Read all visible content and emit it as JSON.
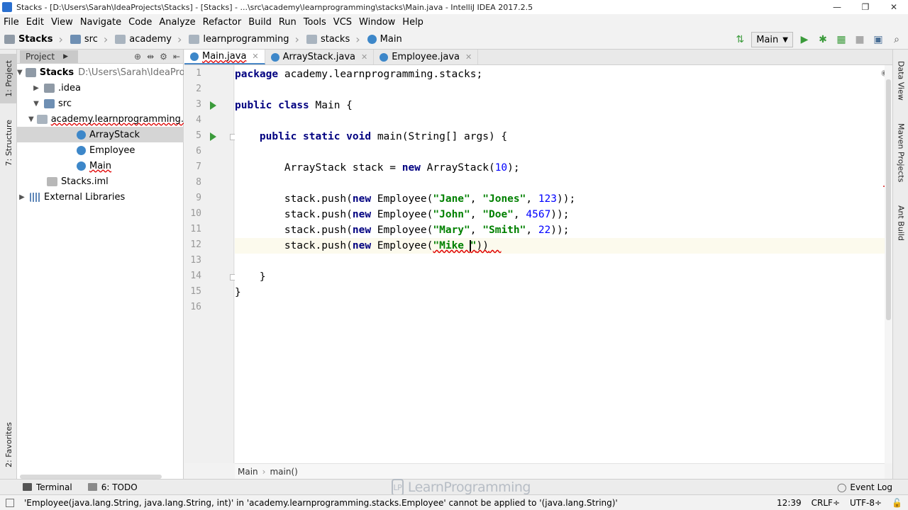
{
  "window": {
    "title": "Stacks - [D:\\Users\\Sarah\\IdeaProjects\\Stacks] - [Stacks] - ...\\src\\academy\\learnprogramming\\stacks\\Main.java - IntelliJ IDEA 2017.2.5",
    "minimize": "—",
    "maximize": "❐",
    "close": "✕"
  },
  "menu": [
    "File",
    "Edit",
    "View",
    "Navigate",
    "Code",
    "Analyze",
    "Refactor",
    "Build",
    "Run",
    "Tools",
    "VCS",
    "Window",
    "Help"
  ],
  "breadcrumbs": [
    "Stacks",
    "src",
    "academy",
    "learnprogramming",
    "stacks",
    "Main"
  ],
  "run_config": {
    "label": "Main"
  },
  "left_tool_tabs": {
    "project": "1: Project",
    "structure": "7: Structure",
    "favorites": "2: Favorites"
  },
  "right_tool_tabs": {
    "data_view": "Data View",
    "maven": "Maven Projects",
    "ant": "Ant Build"
  },
  "project_panel": {
    "tab_label": "Project",
    "tree": [
      {
        "label": "Stacks",
        "extra": "D:\\Users\\Sarah\\IdeaProjects\\"
      },
      {
        "label": ".idea"
      },
      {
        "label": "src"
      },
      {
        "label": "academy.learnprogramming."
      },
      {
        "label": "ArrayStack"
      },
      {
        "label": "Employee"
      },
      {
        "label": "Main"
      },
      {
        "label": "Stacks.iml"
      },
      {
        "label": "External Libraries"
      }
    ]
  },
  "editor_tabs": [
    "Main.java",
    "ArrayStack.java",
    "Employee.java"
  ],
  "code": {
    "line_numbers": [
      "1",
      "2",
      "3",
      "4",
      "5",
      "6",
      "7",
      "8",
      "9",
      "10",
      "11",
      "12",
      "13",
      "14",
      "15",
      "16"
    ],
    "l1": {
      "kw": "package",
      "rest": " academy.learnprogramming.stacks;"
    },
    "l3": {
      "kw1": "public",
      "kw2": "class",
      "rest": " Main {"
    },
    "l5": {
      "indent": "    ",
      "kw1": "public",
      "kw2": "static",
      "kw3": "void",
      "rest": " main(String[] args) {"
    },
    "l7": {
      "indent": "        ",
      "pre": "ArrayStack stack = ",
      "kw": "new",
      "mid": " ArrayStack(",
      "num": "10",
      "post": ");"
    },
    "l9": {
      "indent": "        ",
      "pre": "stack.push(",
      "kw": "new",
      "cls": " Employee(",
      "s1": "\"Jane\"",
      "c1": ", ",
      "s2": "\"Jones\"",
      "c2": ", ",
      "num": "123",
      "post": "));"
    },
    "l10": {
      "indent": "        ",
      "pre": "stack.push(",
      "kw": "new",
      "cls": " Employee(",
      "s1": "\"John\"",
      "c1": ", ",
      "s2": "\"Doe\"",
      "c2": ", ",
      "num": "4567",
      "post": "));"
    },
    "l11": {
      "indent": "        ",
      "pre": "stack.push(",
      "kw": "new",
      "cls": " Employee(",
      "s1": "\"Mary\"",
      "c1": ", ",
      "s2": "\"Smith\"",
      "c2": ", ",
      "num": "22",
      "post": "));"
    },
    "l12": {
      "indent": "        ",
      "pre": "stack.push(",
      "kw": "new",
      "cls": " Employee(",
      "s1a": "\"Mike ",
      "s1b": "\"",
      "post": "))"
    },
    "l14": {
      "indent": "    ",
      "text": "}"
    },
    "l15": {
      "text": "}"
    }
  },
  "editor_breadcrumb": [
    "Main",
    "main()"
  ],
  "bottom_tools": {
    "terminal": "Terminal",
    "todo": "6: TODO",
    "event_log": "Event Log"
  },
  "watermark": "LearnProgramming",
  "status": {
    "message": "'Employee(java.lang.String, java.lang.String, int)' in 'academy.learnprogramming.stacks.Employee' cannot be applied to '(java.lang.String)'",
    "position": "12:39",
    "line_sep": "CRLF÷",
    "encoding": "UTF-8÷"
  },
  "colors": {
    "keyword": "#000080",
    "string": "#008000",
    "number": "#0000ff",
    "run_green": "#3b9b3b",
    "error_red": "#e00000"
  }
}
